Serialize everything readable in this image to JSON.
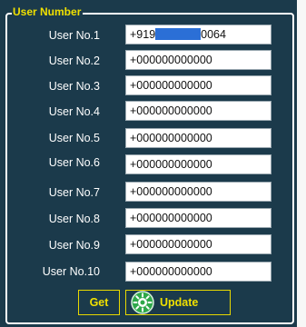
{
  "group": {
    "legend": "User Number"
  },
  "users": [
    {
      "label": "User No.1",
      "value_prefix": "+919",
      "value_suffix": "0064",
      "redacted": true
    },
    {
      "label": "User No.2",
      "value": "+000000000000"
    },
    {
      "label": "User No.3",
      "value": "+000000000000"
    },
    {
      "label": "User No.4",
      "value": "+000000000000"
    },
    {
      "label": "User No.5",
      "value": "+000000000000"
    },
    {
      "label": "User No.6",
      "value": "+000000000000"
    },
    {
      "label": "User No.7",
      "value": "+000000000000"
    },
    {
      "label": "User No.8",
      "value": "+000000000000"
    },
    {
      "label": "User No.9",
      "value": "+000000000000"
    },
    {
      "label": "User No.10",
      "value": "+000000000000"
    }
  ],
  "buttons": {
    "get_label": "Get",
    "update_label": "Update",
    "update_icon": "refresh-gear-icon"
  },
  "colors": {
    "background": "#1b3a4b",
    "accent": "#f0e000",
    "redaction": "#2b6fd6",
    "update_icon": "#2fa84a"
  }
}
